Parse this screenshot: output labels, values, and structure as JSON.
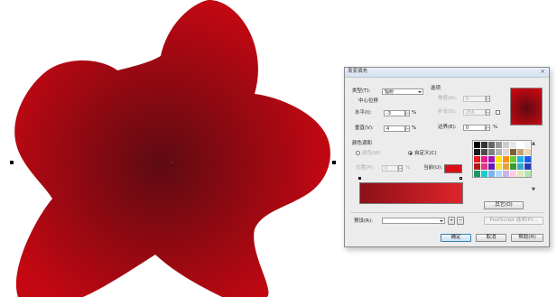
{
  "colors": {
    "shape_center": "#5e0a12",
    "shape_edge": "#c40812",
    "custom_color_swatch": "#d80f18",
    "ramp_start": "#8c1018",
    "ramp_end": "#e0242b"
  },
  "dialog": {
    "title": "渐变填充",
    "close_label": "×",
    "type_label": "类型(T):",
    "type_value": "辐射",
    "center_offset_label": "中心位移",
    "horizontal_label": "水平(I):",
    "horizontal_value": "-3",
    "vertical_label": "垂直(V):",
    "vertical_value": "4",
    "percent": "%",
    "options_label": "选项",
    "angle_label": "角度(A):",
    "angle_value": "0",
    "steps_label": "步长(S):",
    "steps_value": "256",
    "edge_pad_label": "边界(E):",
    "edge_pad_value": "0",
    "color_blend_label": "颜色调和",
    "two_color_label": "双色(W)",
    "custom_label": "自定义(C)",
    "position_label": "位置(P):",
    "position_value": "0",
    "current_label": "当前(U):",
    "others_button": "其它(O)",
    "preset_label": "预设(R):",
    "preset_value": "",
    "add_preset_icon": "+",
    "remove_preset_icon": "−",
    "postscript_button": "PostScript 选项(P)...",
    "ok_button": "确定",
    "cancel_button": "取消",
    "help_button": "帮助(H)"
  },
  "palette": {
    "colors": [
      "#000000",
      "#333333",
      "#666666",
      "#999999",
      "#cccccc",
      "#e6e6e6",
      "#ffffff",
      "#f2f2f2",
      "#1a1a1a",
      "#4d4d4d",
      "#808080",
      "#b3b3b3",
      "#d9d9d9",
      "#7f5c3a",
      "#c8a070",
      "#e8d8b0",
      "#e51a1a",
      "#e51a8c",
      "#a01ab0",
      "#ffe600",
      "#ff8c1a",
      "#66cc33",
      "#1ab0e6",
      "#1a5ce6",
      "#b31a1a",
      "#e6337f",
      "#6a1ab3",
      "#f0e040",
      "#e6a040",
      "#339933",
      "#33a6cc",
      "#2a3db0",
      "#1a9966",
      "#1acccc",
      "#80b3e6",
      "#b3d9ff",
      "#ccb3e6",
      "#ffcce6",
      "#e6e6b3",
      "#b3e6b3"
    ]
  }
}
